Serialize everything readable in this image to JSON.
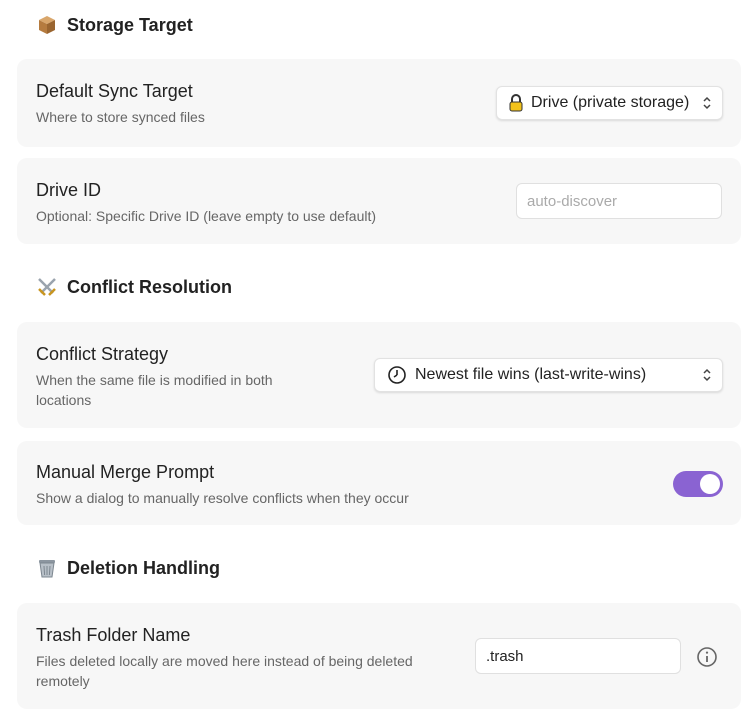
{
  "sections": {
    "storage": {
      "title": "Storage Target",
      "icon": "package-icon"
    },
    "conflict": {
      "title": "Conflict Resolution",
      "icon": "crossed-swords-icon"
    },
    "deletion": {
      "title": "Deletion Handling",
      "icon": "wastebasket-icon"
    }
  },
  "settings": {
    "default_sync_target": {
      "title": "Default Sync Target",
      "description": "Where to store synced files",
      "selected": "Drive (private storage)",
      "option_icon": "lock-icon"
    },
    "drive_id": {
      "title": "Drive ID",
      "description": "Optional: Specific Drive ID (leave empty to use default)",
      "value": "",
      "placeholder": "auto-discover"
    },
    "conflict_strategy": {
      "title": "Conflict Strategy",
      "description_line1": "When the same file is modified in both",
      "description_line2": "locations",
      "selected": "Newest file wins (last-write-wins)",
      "option_icon": "clock-icon"
    },
    "manual_merge_prompt": {
      "title": "Manual Merge Prompt",
      "description": "Show a dialog to manually resolve conflicts when they occur",
      "enabled": true
    },
    "trash_folder_name": {
      "title": "Trash Folder Name",
      "description_line1": "Files deleted locally are moved here instead of being deleted",
      "description_line2": "remotely",
      "value": ".trash",
      "info_icon": "info-icon"
    }
  },
  "colors": {
    "toggle_on": "#8a63d2",
    "card_bg": "#f7f7f7",
    "muted_text": "#666666"
  }
}
